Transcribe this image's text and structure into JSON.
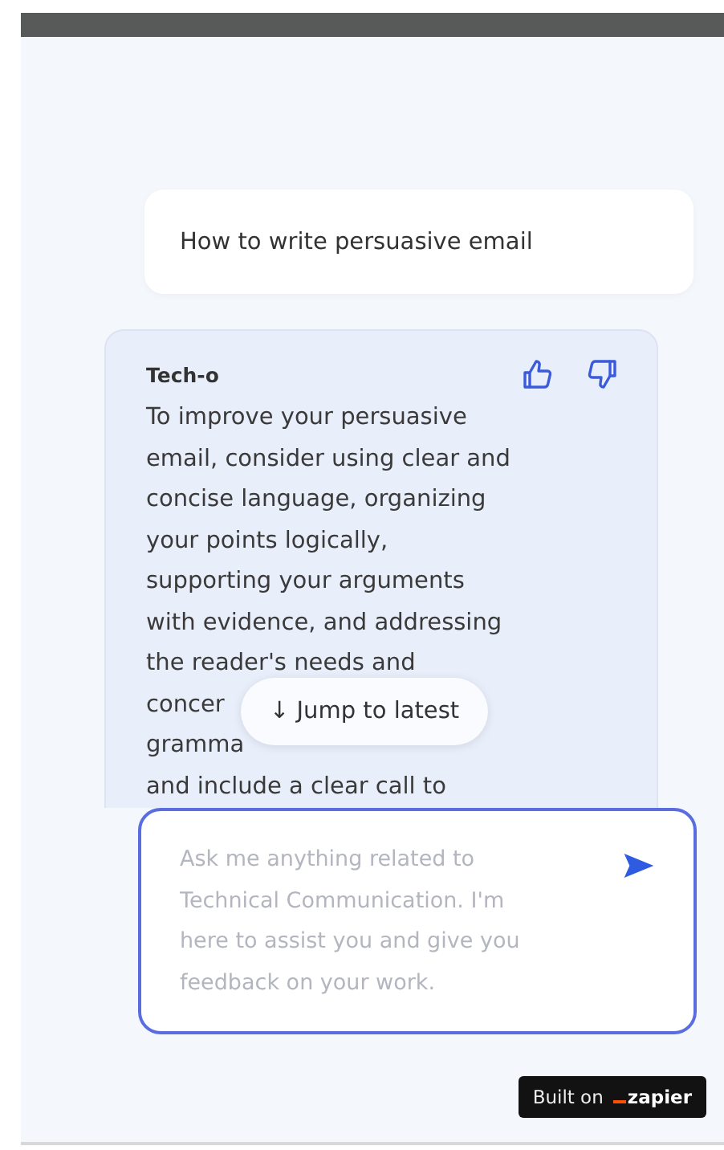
{
  "user_message": {
    "text": "How to write persuasive email"
  },
  "bot_message": {
    "sender": "Tech-o",
    "lines": [
      "To improve your persuasive",
      "email, consider using clear and",
      "concise language, organizing",
      "your points logically,",
      "supporting your arguments",
      "with evidence, and addressing",
      "the reader's needs and",
      "concer",
      "gramma",
      "and include a clear call to"
    ]
  },
  "jump_button": {
    "label": "↓ Jump to latest"
  },
  "composer": {
    "placeholder": "Ask me anything related to Technical Communication. I'm here to assist you and give you feedback on your work."
  },
  "badge": {
    "prefix": "Built on",
    "brand": "zapier"
  }
}
